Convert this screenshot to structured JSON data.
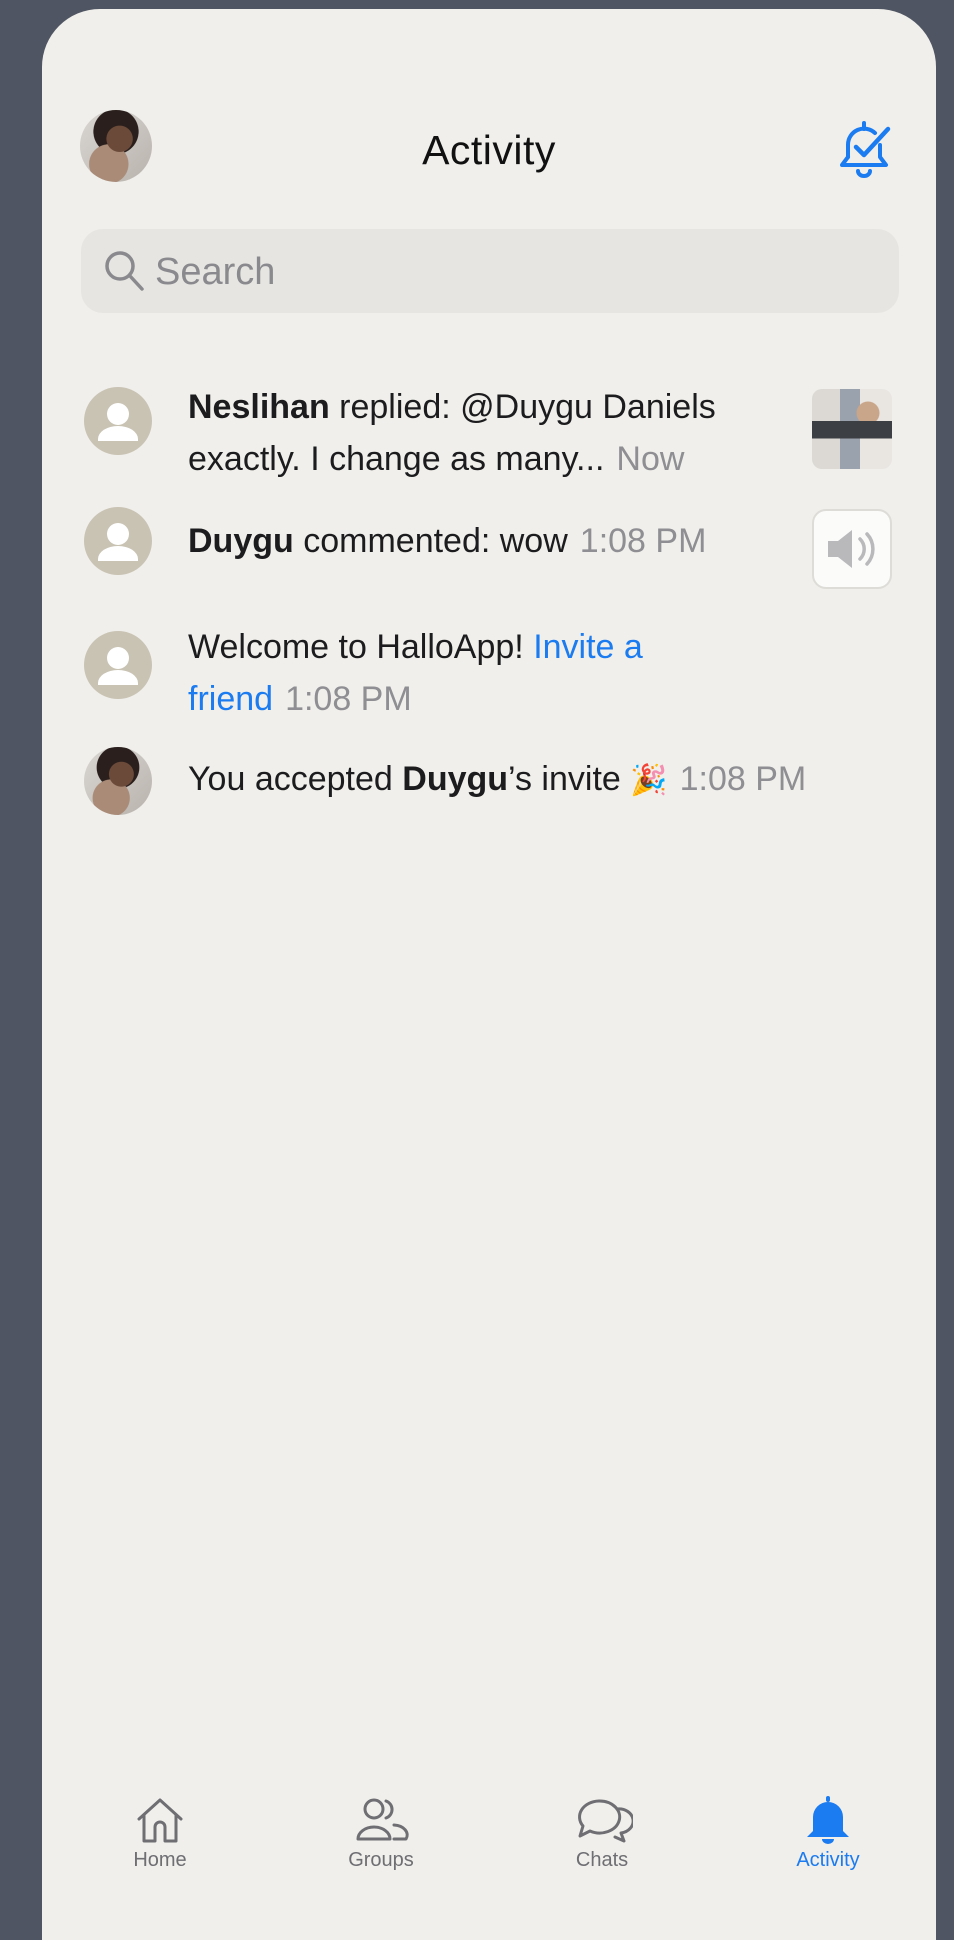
{
  "header": {
    "title": "Activity",
    "mark_read_icon": "bell-check-icon",
    "profile_icon": "profile-avatar"
  },
  "search": {
    "placeholder": "Search"
  },
  "activities": [
    {
      "actor": "Neslihan",
      "action": " replied: @Duygu Daniels exactly. I change as many...",
      "time": "Now",
      "attachment": "photo-thumbnail"
    },
    {
      "actor": "Duygu",
      "action": " commented: wow",
      "time": "1:08 PM",
      "attachment": "audio-thumbnail"
    },
    {
      "prefix": "Welcome to HalloApp! ",
      "link": "Invite a friend",
      "time": "1:08 PM"
    },
    {
      "prefix": "You accepted ",
      "actor": "Duygu",
      "suffix": "’s invite ",
      "emoji": "🎉",
      "time": "1:08 PM"
    }
  ],
  "tabs": [
    {
      "label": "Home",
      "icon": "home-icon"
    },
    {
      "label": "Groups",
      "icon": "groups-icon"
    },
    {
      "label": "Chats",
      "icon": "chats-icon"
    },
    {
      "label": "Activity",
      "icon": "bell-icon",
      "active": true
    }
  ],
  "colors": {
    "accent": "#1b7bf0",
    "background": "#f0efeb",
    "frame": "#4f5562",
    "secondary_text": "#8e8e93"
  }
}
